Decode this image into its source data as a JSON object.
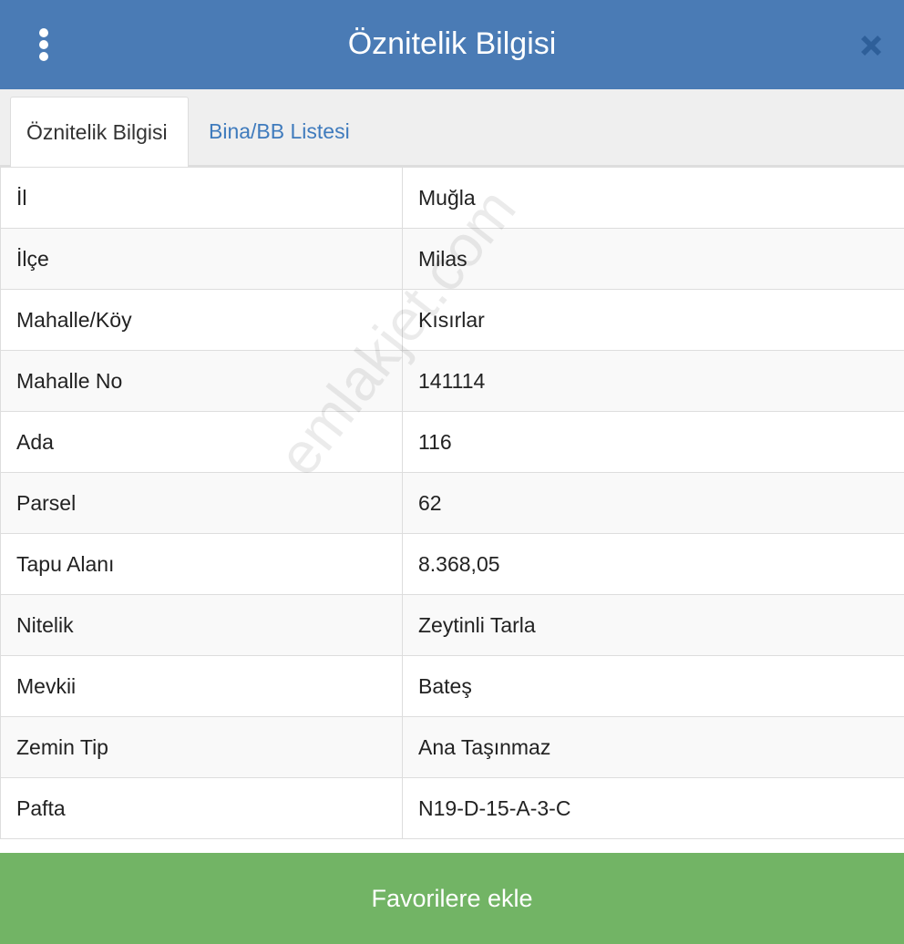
{
  "header": {
    "title": "Öznitelik Bilgisi",
    "menu_icon": "vertical-dots-icon",
    "close_icon": "close-x-icon"
  },
  "tabs": [
    {
      "label": "Öznitelik Bilgisi",
      "active": true
    },
    {
      "label": "Bina/BB Listesi",
      "active": false
    }
  ],
  "attributes": [
    {
      "key": "İl",
      "value": "Muğla"
    },
    {
      "key": "İlçe",
      "value": "Milas"
    },
    {
      "key": "Mahalle/Köy",
      "value": "Kısırlar"
    },
    {
      "key": "Mahalle No",
      "value": "141114"
    },
    {
      "key": "Ada",
      "value": "116"
    },
    {
      "key": "Parsel",
      "value": "62"
    },
    {
      "key": "Tapu Alanı",
      "value": "8.368,05"
    },
    {
      "key": "Nitelik",
      "value": "Zeytinli Tarla"
    },
    {
      "key": "Mevkii",
      "value": "Bateş"
    },
    {
      "key": "Zemin Tip",
      "value": "Ana Taşınmaz"
    },
    {
      "key": "Pafta",
      "value": "N19-D-15-A-3-C"
    }
  ],
  "watermark": "emlakjet.com",
  "footer": {
    "button_label": "Favorilere ekle"
  },
  "colors": {
    "header_bg": "#4a7bb5",
    "tab_link": "#3f7bbd",
    "footer_bg": "#72b465",
    "close_icon": "#2e5f99"
  }
}
